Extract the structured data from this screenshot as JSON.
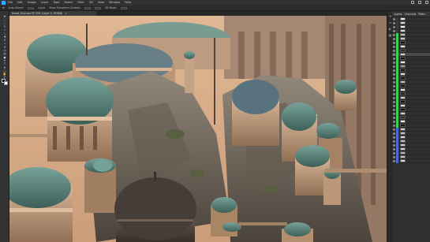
{
  "app": {
    "name": "Adobe Photoshop",
    "accent_color": "#31a8ff",
    "highlight_color": "#39d353"
  },
  "menubar": {
    "items": [
      "File",
      "Edit",
      "Image",
      "Layer",
      "Type",
      "Select",
      "Filter",
      "3D",
      "View",
      "Window",
      "Help"
    ]
  },
  "options": {
    "tool_preset": "Auto-Select:",
    "layer_mode": "Layer",
    "show_transform": "Show Transform Controls",
    "mode_3d": "3D Mode:"
  },
  "document": {
    "tab_label": "theed_final.psd @ 50% (Layer 0, RGB/8)",
    "close_glyph": "×"
  },
  "tools": [
    {
      "icon": "move-tool-icon",
      "glyph": "✥"
    },
    {
      "icon": "marquee-tool-icon",
      "glyph": "⬚"
    },
    {
      "icon": "lasso-tool-icon",
      "glyph": "◌"
    },
    {
      "icon": "quick-select-tool-icon",
      "glyph": "✎"
    },
    {
      "icon": "crop-tool-icon",
      "glyph": "⌗"
    },
    {
      "icon": "eyedropper-tool-icon",
      "glyph": "⤡"
    },
    {
      "icon": "healing-tool-icon",
      "glyph": "✚"
    },
    {
      "icon": "brush-tool-icon",
      "glyph": "✐"
    },
    {
      "icon": "stamp-tool-icon",
      "glyph": "⊥"
    },
    {
      "icon": "history-brush-tool-icon",
      "glyph": "↺"
    },
    {
      "icon": "eraser-tool-icon",
      "glyph": "▭"
    },
    {
      "icon": "gradient-tool-icon",
      "glyph": "▤"
    },
    {
      "icon": "dodge-tool-icon",
      "glyph": "●"
    },
    {
      "icon": "pen-tool-icon",
      "glyph": "✒"
    },
    {
      "icon": "type-tool-icon",
      "glyph": "T"
    },
    {
      "icon": "path-select-tool-icon",
      "glyph": "➤"
    },
    {
      "icon": "shape-tool-icon",
      "glyph": "▢"
    },
    {
      "icon": "hand-tool-icon",
      "glyph": "✋"
    },
    {
      "icon": "zoom-tool-icon",
      "glyph": "⚲"
    }
  ],
  "layers_panel": {
    "tabs": [
      "Layers",
      "Channels",
      "Paths"
    ],
    "layers": [
      {
        "tag": "#3a3a3a",
        "thumb": "#e8e8e8"
      },
      {
        "tag": "#3a3a3a",
        "thumb": "#dcdcdc"
      },
      {
        "tag": "#3a3a3a",
        "thumb": "#f0f0f0"
      },
      {
        "tag": "#3a3a3a",
        "thumb": "#d8d8d8"
      },
      {
        "tag": "#39d353",
        "thumb": "#bfbfbf"
      },
      {
        "tag": "#39d353",
        "thumb": "#c8c8c8"
      },
      {
        "tag": "#39d353",
        "thumb": "#111111"
      },
      {
        "tag": "#39d353",
        "thumb": "#e0e0e0"
      },
      {
        "tag": "#39d353",
        "thumb": "#2a2a2a"
      },
      {
        "tag": "#39d353",
        "thumb": "#d4d4d4"
      },
      {
        "tag": "#39d353",
        "thumb": "#111111"
      },
      {
        "tag": "#39d353",
        "thumb": "#e6e6e6"
      },
      {
        "tag": "#39d353",
        "thumb": "#999999"
      },
      {
        "tag": "#39d353",
        "thumb": "#111111"
      },
      {
        "tag": "#39d353",
        "thumb": "#dcdcdc"
      },
      {
        "tag": "#39d353",
        "thumb": "#111111"
      },
      {
        "tag": "#39d353",
        "thumb": "#bdbdbd"
      },
      {
        "tag": "#39d353",
        "thumb": "#111111"
      },
      {
        "tag": "#39d353",
        "thumb": "#e4e4e4"
      },
      {
        "tag": "#39d353",
        "thumb": "#202020"
      },
      {
        "tag": "#39d353",
        "thumb": "#cfcfcf"
      },
      {
        "tag": "#39d353",
        "thumb": "#111111"
      },
      {
        "tag": "#39d353",
        "thumb": "#e0e0e0"
      },
      {
        "tag": "#39d353",
        "thumb": "#111111"
      },
      {
        "tag": "#39d353",
        "thumb": "#d0d0d0"
      },
      {
        "tag": "#39d353",
        "thumb": "#2a2a2a"
      },
      {
        "tag": "#39d353",
        "thumb": "#e8e8e8"
      },
      {
        "tag": "#39d353",
        "thumb": "#111111"
      },
      {
        "tag": "#4b6bd8",
        "thumb": "#cfcfcf"
      },
      {
        "tag": "#4b6bd8",
        "thumb": "#c4c4c4"
      },
      {
        "tag": "#4b6bd8",
        "thumb": "#d8d8d8"
      },
      {
        "tag": "#4b6bd8",
        "thumb": "#bfbfbf"
      },
      {
        "tag": "#4b6bd8",
        "thumb": "#cccccc"
      },
      {
        "tag": "#4b6bd8",
        "thumb": "#d4d4d4"
      },
      {
        "tag": "#4b6bd8",
        "thumb": "#b8b8b8"
      },
      {
        "tag": "#4b6bd8",
        "thumb": "#c8c8c8"
      },
      {
        "tag": "#4b6bd8",
        "thumb": "#dddddd"
      }
    ]
  }
}
